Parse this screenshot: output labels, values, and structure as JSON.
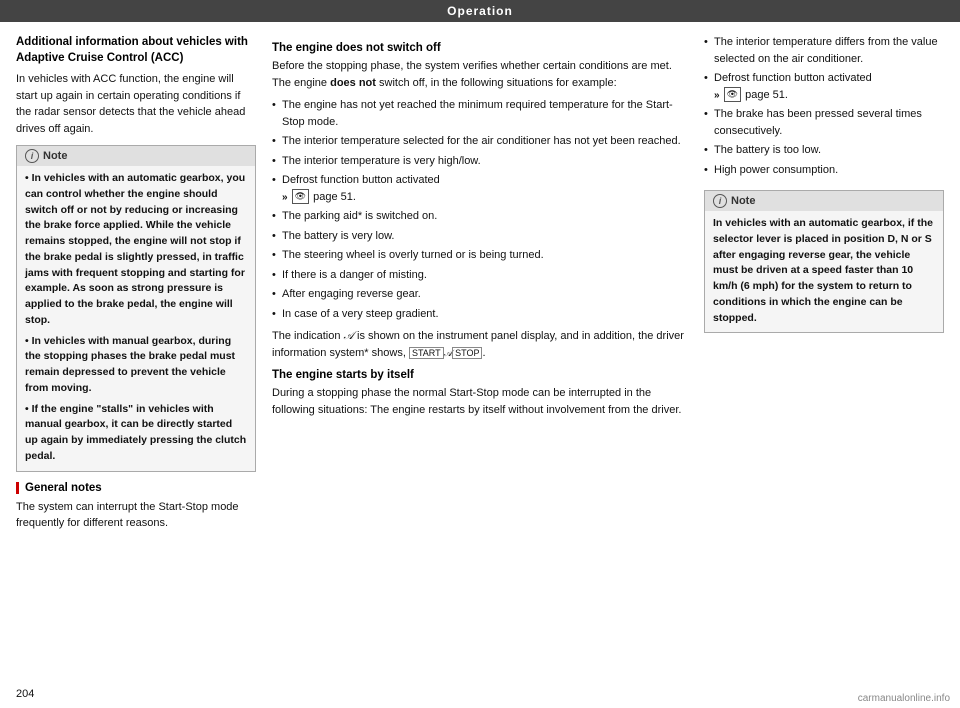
{
  "topbar": {
    "label": "Operation"
  },
  "left_col": {
    "main_title": "Additional information about vehicles with Adaptive Cruise Control (ACC)",
    "intro_text": "In vehicles with ACC function, the engine will start up again in certain operating conditions if the radar sensor detects that the vehicle ahead drives off again.",
    "note_label": "Note",
    "note_bullets": [
      "In vehicles with an automatic gearbox, you can control whether the engine should switch off or not by reducing or increasing the brake force applied. While the vehicle remains stopped, the engine will not stop if the brake pedal is slightly pressed, in traffic jams with frequent stopping and starting for example. As soon as strong pressure is applied to the brake pedal, the engine will stop.",
      "In vehicles with manual gearbox, during the stopping phases the brake pedal must remain depressed to prevent the vehicle from moving.",
      "If the engine \"stalls\" in vehicles with manual gearbox, it can be directly started up again by immediately pressing the clutch pedal."
    ],
    "general_notes_title": "General notes",
    "general_notes_text": "The system can interrupt the Start-Stop mode frequently for different reasons."
  },
  "center_col": {
    "section1_title": "The engine does not switch off",
    "section1_intro": "Before the stopping phase, the system verifies whether certain conditions are met. The engine does not switch off, in the following situations for example:",
    "bullets1": [
      "The engine has not yet reached the minimum required temperature for the Start-Stop mode.",
      "The interior temperature selected for the air conditioner has not yet been reached.",
      "The interior temperature is very high/low.",
      "Defrost function button activated",
      "page 51.",
      "The parking aid* is switched on.",
      "The battery is very low.",
      "The steering wheel is overly turned or is being turned.",
      "If there is a danger of misting.",
      "After engaging reverse gear.",
      "In case of a very steep gradient."
    ],
    "indication_text": "The indication is shown on the instrument panel display, and in addition, the driver information system* shows,",
    "section2_title": "The engine starts by itself",
    "section2_text": "During a stopping phase the normal Start-Stop mode can be interrupted in the following situations: The engine restarts by itself without involvement from the driver."
  },
  "right_col": {
    "bullets": [
      "The interior temperature differs from the value selected on the air conditioner.",
      "Defrost function button activated",
      "page 51.",
      "The brake has been pressed several times consecutively.",
      "The battery is too low.",
      "High power consumption."
    ],
    "note_label": "Note",
    "note_text": "In vehicles with an automatic gearbox, if the selector lever is placed in position D, N or S after engaging reverse gear, the vehicle must be driven at a speed faster than 10 km/h (6 mph) for the system to return to conditions in which the engine can be stopped."
  },
  "page_number": "204",
  "watermark": "carmanualonline.info"
}
